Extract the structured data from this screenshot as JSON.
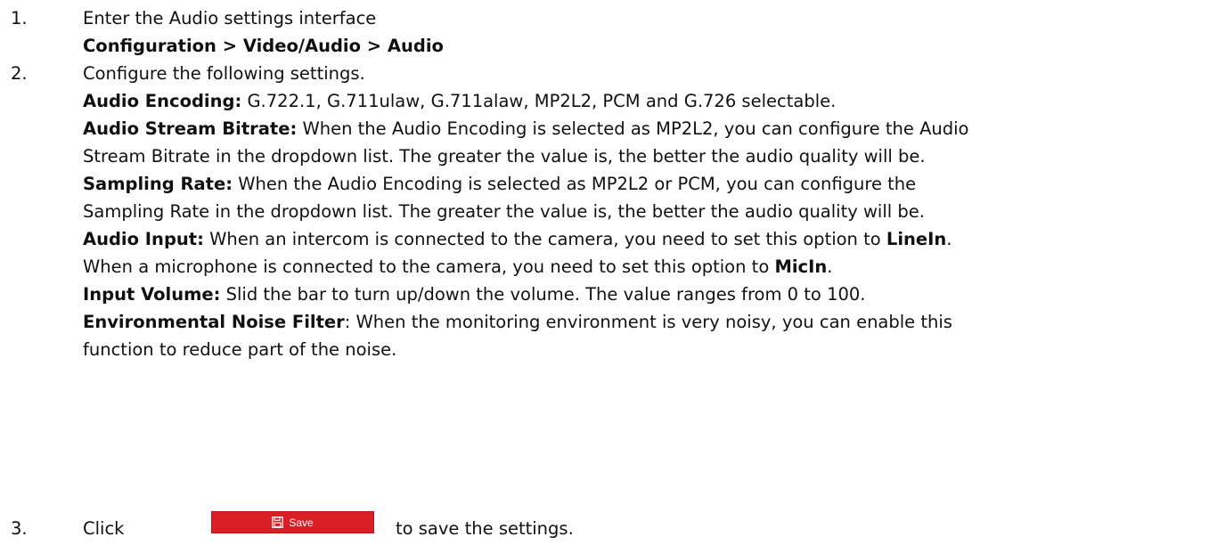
{
  "steps": [
    {
      "number": "1.",
      "text": "Enter the Audio settings interface",
      "path": "Configuration > Video/Audio > Audio"
    },
    {
      "number": "2.",
      "intro": "Configure the following settings.",
      "items": [
        {
          "term": "Audio Encoding:",
          "lines": [
            " G.722.1, G.711ulaw, G.711alaw, MP2L2, PCM and G.726 selectable."
          ]
        },
        {
          "term": "Audio Stream Bitrate:",
          "lines": [
            " When the Audio Encoding is selected as MP2L2, you can configure the Audio",
            "Stream Bitrate in the dropdown list. The greater the value is, the better the audio quality will be."
          ]
        },
        {
          "term": "Sampling Rate:",
          "lines": [
            " When the Audio Encoding is selected as MP2L2 or PCM, you can configure the",
            "Sampling Rate in the dropdown list. The greater the value is, the better the audio quality will be."
          ]
        },
        {
          "term": "Audio Input:",
          "line1_text": " When an intercom is connected to the camera, you need to set this option to ",
          "line1_bold": "LineIn",
          "line1_end": ".",
          "line2_text": "When a microphone is connected to the camera, you need to set this option to ",
          "line2_bold": "MicIn",
          "line2_end": "."
        },
        {
          "term": "Input Volume:",
          "lines": [
            " Slid the bar to turn up/down the volume. The value ranges from 0 to 100."
          ]
        },
        {
          "term": "Environmental Noise Filter",
          "lines": [
            ": When the monitoring environment is very noisy, you can enable this",
            "function to reduce part of the noise."
          ]
        }
      ]
    },
    {
      "number": "3.",
      "click_label": "Click",
      "button_label": "Save",
      "button_icon": "save-icon",
      "tail": "to save the settings."
    }
  ],
  "colors": {
    "button_background": "#d81f26",
    "button_text": "#ffffff",
    "text": "#111111"
  }
}
